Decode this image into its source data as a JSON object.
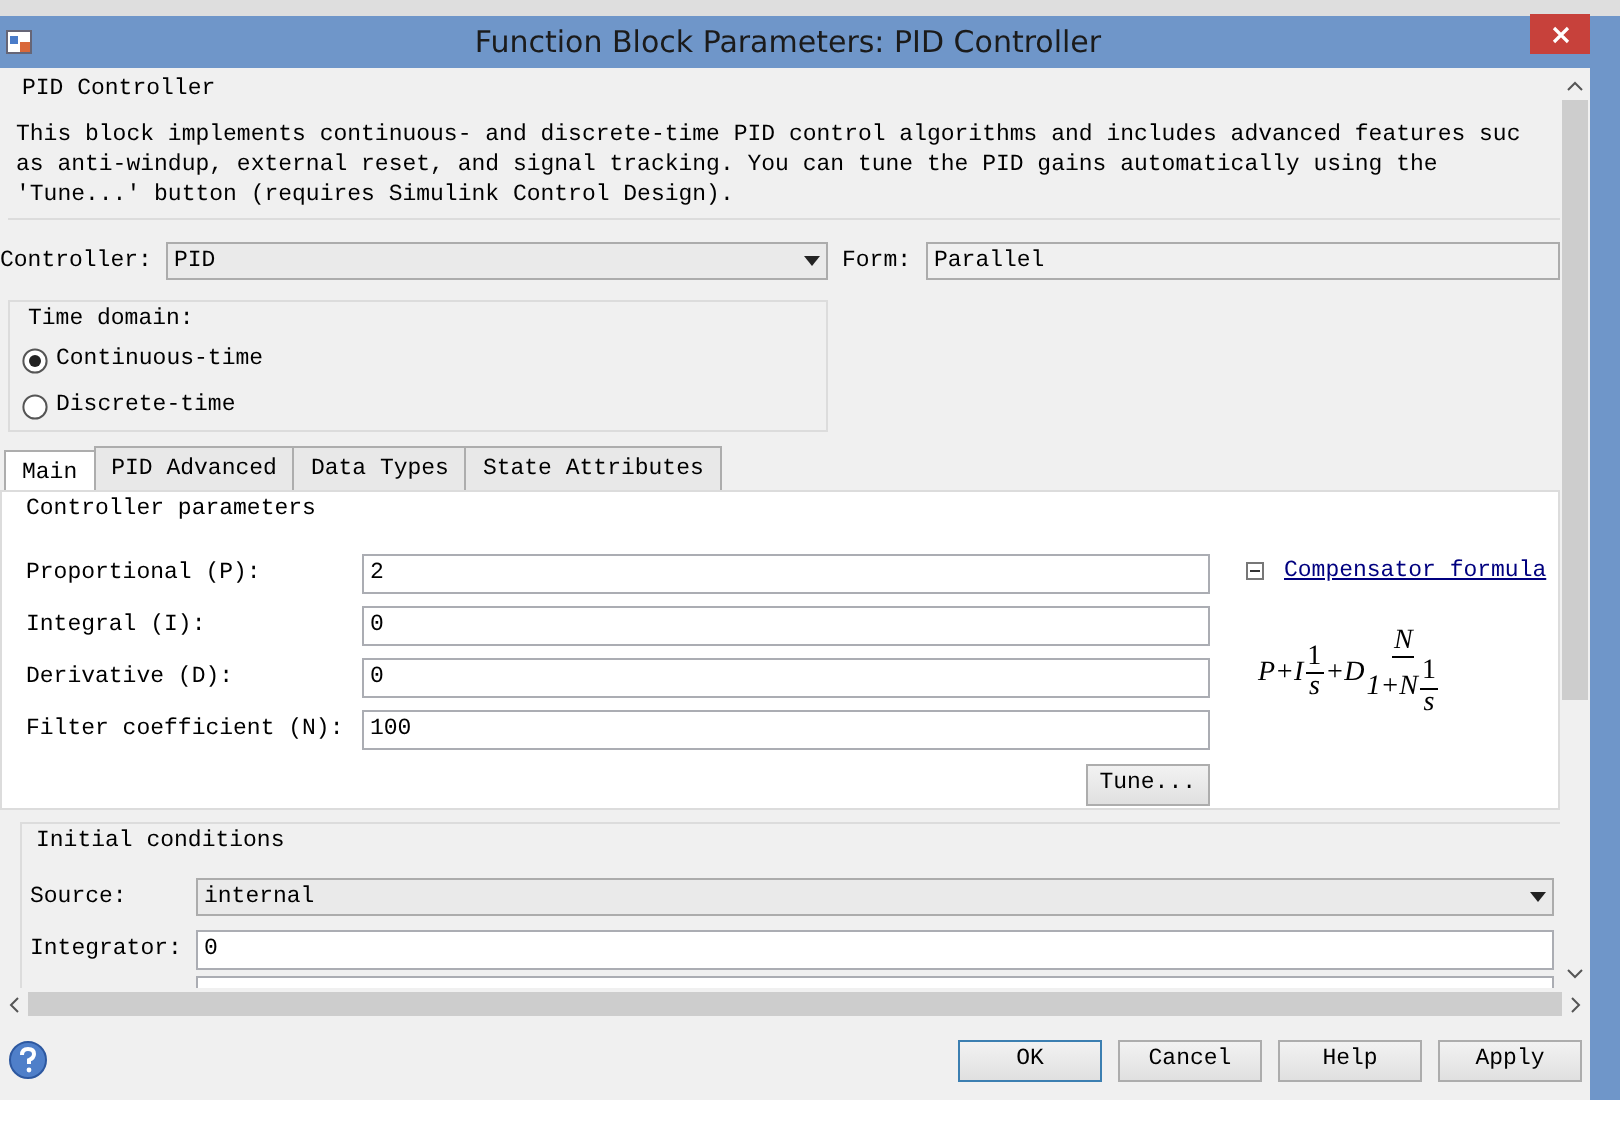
{
  "window": {
    "title": "Function Block Parameters: PID Controller"
  },
  "block": {
    "title": "PID Controller",
    "description": [
      "This block implements continuous- and discrete-time PID control algorithms and includes advanced features suc",
      "as anti-windup, external reset, and signal tracking. You can tune the PID gains automatically using the",
      "'Tune...' button (requires Simulink Control Design)."
    ]
  },
  "controller": {
    "label": "Controller:",
    "value": "PID"
  },
  "form": {
    "label": "Form:",
    "value": "Parallel"
  },
  "time_domain": {
    "title": "Time domain:",
    "options": [
      {
        "label": "Continuous-time",
        "selected": true
      },
      {
        "label": "Discrete-time",
        "selected": false
      }
    ]
  },
  "tabs": [
    {
      "label": "Main",
      "selected": true
    },
    {
      "label": "PID Advanced",
      "selected": false
    },
    {
      "label": "Data Types",
      "selected": false
    },
    {
      "label": "State Attributes",
      "selected": false
    }
  ],
  "controller_parameters": {
    "title": "Controller parameters",
    "fields": [
      {
        "label": "Proportional (P):",
        "value": "2"
      },
      {
        "label": "Integral (I):",
        "value": "0"
      },
      {
        "label": "Derivative (D):",
        "value": "0"
      },
      {
        "label": "Filter coefficient (N):",
        "value": "100"
      }
    ],
    "tune_button": "Tune...",
    "formula_link": {
      "label": "Compensator formula",
      "expanded": true
    },
    "formula": {
      "lead": "P+I",
      "i_num": "1",
      "i_den": "s",
      "mid": "+D",
      "num": "N",
      "den_lead": "1+N",
      "den_num": "1",
      "den_den": "s"
    }
  },
  "initial_conditions": {
    "title": "Initial conditions",
    "source": {
      "label": "Source:",
      "value": "internal"
    },
    "integrator": {
      "label": "Integrator:",
      "value": "0"
    }
  },
  "buttons": [
    {
      "label": "OK",
      "focused": true
    },
    {
      "label": "Cancel",
      "focused": false
    },
    {
      "label": "Help",
      "focused": false
    },
    {
      "label": "Apply",
      "focused": false
    }
  ]
}
